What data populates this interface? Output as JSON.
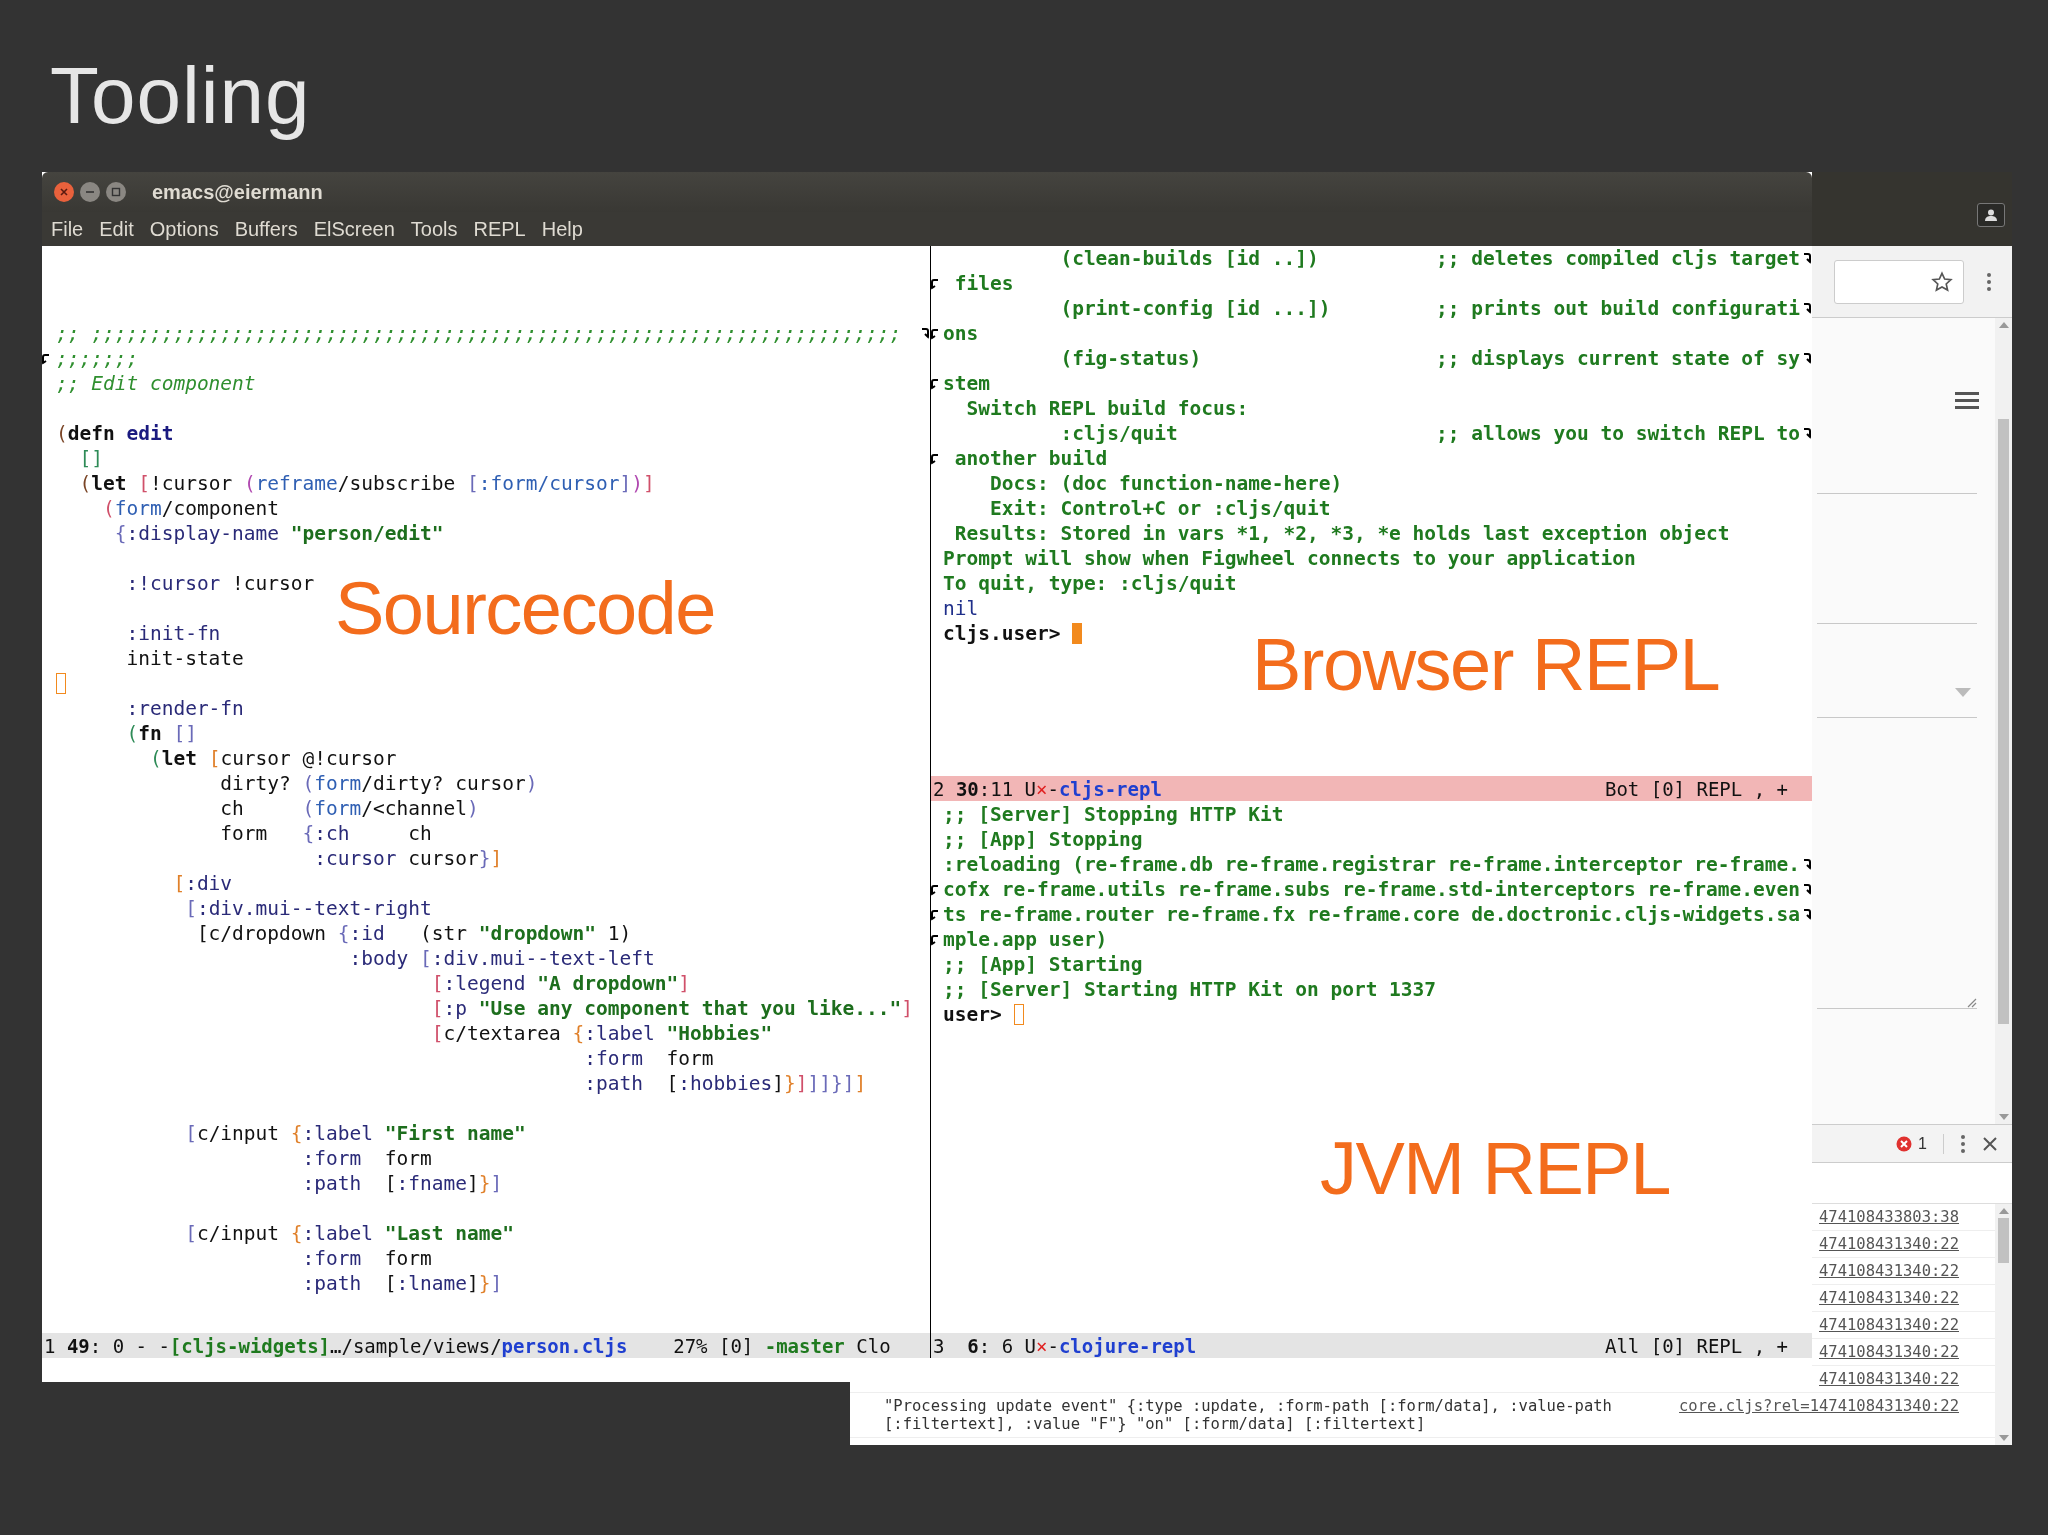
{
  "slide_title": "Tooling",
  "emacs": {
    "title": "emacs@eiermann",
    "menu": [
      "File",
      "Edit",
      "Options",
      "Buffers",
      "ElScreen",
      "Tools",
      "REPL",
      "Help"
    ],
    "source_window": {
      "focused": false,
      "lines": [
        {
          "kind": "code",
          "wraps": true,
          "continued": false,
          "segs": [
            {
              "kind": "comment",
              "text": ";; ;;;;;;;;;;;;;;;;;;;;;;;;;;;;;;;;;;;;;;;;;;;;;;;;;;;;;;;;;;;;;;;;;;;;;"
            }
          ]
        },
        {
          "kind": "code",
          "wraps": false,
          "continued": true,
          "segs": [
            {
              "kind": "comment",
              "text": ";;;;;;;"
            }
          ]
        },
        {
          "kind": "code",
          "wraps": false,
          "continued": false,
          "segs": [
            {
              "kind": "comment",
              "text": ";; Edit component"
            }
          ]
        },
        {
          "kind": "blank"
        },
        {
          "kind": "code",
          "wraps": false,
          "continued": false,
          "segs": [
            {
              "kind": "paren1",
              "text": "("
            },
            {
              "kind": "special",
              "text": "defn"
            },
            {
              "kind": "fname",
              "text": " edit"
            }
          ]
        },
        {
          "kind": "code",
          "wraps": false,
          "continued": false,
          "segs": [
            {
              "kind": "paren2",
              "text": "  []"
            }
          ]
        },
        {
          "kind": "code",
          "wraps": false,
          "continued": false,
          "segs": [
            {
              "kind": "paren1",
              "text": "  ("
            },
            {
              "kind": "special",
              "text": "let"
            },
            {
              "kind": "paren3",
              "text": " ["
            },
            {
              "kind": "plain",
              "text": "!cursor "
            },
            {
              "kind": "paren4",
              "text": "("
            },
            {
              "kind": "ns",
              "text": "reframe"
            },
            {
              "kind": "plain",
              "text": "/subscribe "
            },
            {
              "kind": "paren5",
              "text": "["
            },
            {
              "kind": "ns",
              "text": ":form/cursor"
            },
            {
              "kind": "paren5",
              "text": "]"
            },
            {
              "kind": "paren4",
              "text": ")"
            },
            {
              "kind": "paren3",
              "text": "]"
            }
          ]
        },
        {
          "kind": "code",
          "wraps": false,
          "continued": false,
          "segs": [
            {
              "kind": "paren3",
              "text": "    ("
            },
            {
              "kind": "ns",
              "text": "form"
            },
            {
              "kind": "plain",
              "text": "/component"
            }
          ]
        },
        {
          "kind": "code",
          "wraps": false,
          "continued": false,
          "segs": [
            {
              "kind": "paren5",
              "text": "     {"
            },
            {
              "kind": "kw",
              "text": ":display-name"
            },
            {
              "kind": "string",
              "text": " \"person/edit\""
            }
          ]
        },
        {
          "kind": "blank"
        },
        {
          "kind": "code",
          "wraps": false,
          "continued": false,
          "segs": [
            {
              "kind": "kw",
              "text": "      :!cursor"
            },
            {
              "kind": "plain",
              "text": " !cursor"
            }
          ]
        },
        {
          "kind": "blank"
        },
        {
          "kind": "code",
          "wraps": false,
          "continued": false,
          "segs": [
            {
              "kind": "kw",
              "text": "      :init-fn"
            }
          ]
        },
        {
          "kind": "code",
          "wraps": false,
          "continued": false,
          "segs": [
            {
              "kind": "plain",
              "text": "      init-state"
            }
          ]
        },
        {
          "kind": "cursor"
        },
        {
          "kind": "code",
          "wraps": false,
          "continued": false,
          "segs": [
            {
              "kind": "kw",
              "text": "      :render-fn"
            }
          ]
        },
        {
          "kind": "code",
          "wraps": false,
          "continued": false,
          "segs": [
            {
              "kind": "paren2",
              "text": "      ("
            },
            {
              "kind": "special",
              "text": "fn"
            },
            {
              "kind": "paren5",
              "text": " []"
            }
          ]
        },
        {
          "kind": "code",
          "wraps": false,
          "continued": false,
          "segs": [
            {
              "kind": "paren2",
              "text": "        ("
            },
            {
              "kind": "special",
              "text": "let"
            },
            {
              "kind": "paren6",
              "text": " ["
            },
            {
              "kind": "plain",
              "text": "cursor @!cursor"
            }
          ]
        },
        {
          "kind": "code",
          "wraps": false,
          "continued": false,
          "segs": [
            {
              "kind": "plain",
              "text": "              dirty? "
            },
            {
              "kind": "paren5",
              "text": "("
            },
            {
              "kind": "ns",
              "text": "form"
            },
            {
              "kind": "plain",
              "text": "/dirty? cursor"
            },
            {
              "kind": "paren5",
              "text": ")"
            }
          ]
        },
        {
          "kind": "code",
          "wraps": false,
          "continued": false,
          "segs": [
            {
              "kind": "plain",
              "text": "              ch     "
            },
            {
              "kind": "paren5",
              "text": "("
            },
            {
              "kind": "ns",
              "text": "form"
            },
            {
              "kind": "plain",
              "text": "/<channel"
            },
            {
              "kind": "paren5",
              "text": ")"
            }
          ]
        },
        {
          "kind": "code",
          "wraps": false,
          "continued": false,
          "segs": [
            {
              "kind": "plain",
              "text": "              form   "
            },
            {
              "kind": "paren5",
              "text": "{"
            },
            {
              "kind": "kw",
              "text": ":ch"
            },
            {
              "kind": "plain",
              "text": "     ch"
            }
          ]
        },
        {
          "kind": "code",
          "wraps": false,
          "continued": false,
          "segs": [
            {
              "kind": "kw",
              "text": "                      :cursor"
            },
            {
              "kind": "plain",
              "text": " cursor"
            },
            {
              "kind": "paren5",
              "text": "}"
            },
            {
              "kind": "paren6",
              "text": "]"
            }
          ]
        },
        {
          "kind": "code",
          "wraps": false,
          "continued": false,
          "segs": [
            {
              "kind": "paren6",
              "text": "          ["
            },
            {
              "kind": "kw",
              "text": ":div"
            }
          ]
        },
        {
          "kind": "code",
          "wraps": false,
          "continued": false,
          "segs": [
            {
              "kind": "paren5",
              "text": "           ["
            },
            {
              "kind": "kw",
              "text": ":div.mui--text-right"
            }
          ]
        },
        {
          "kind": "code",
          "wraps": false,
          "continued": false,
          "segs": [
            {
              "kind": "plain",
              "text": "            [c/dropdown "
            },
            {
              "kind": "paren5",
              "text": "{"
            },
            {
              "kind": "kw",
              "text": ":id"
            },
            {
              "kind": "plain",
              "text": "   (str "
            },
            {
              "kind": "string",
              "text": "\"dropdown\""
            },
            {
              "kind": "plain",
              "text": " 1)"
            }
          ]
        },
        {
          "kind": "code",
          "wraps": false,
          "continued": false,
          "segs": [
            {
              "kind": "kw",
              "text": "                         :body"
            },
            {
              "kind": "paren5",
              "text": " ["
            },
            {
              "kind": "kw",
              "text": ":div.mui--text-left"
            }
          ]
        },
        {
          "kind": "code",
          "wraps": false,
          "continued": false,
          "segs": [
            {
              "kind": "paren3",
              "text": "                                ["
            },
            {
              "kind": "kw",
              "text": ":legend"
            },
            {
              "kind": "string",
              "text": " \"A dropdown\""
            },
            {
              "kind": "paren3",
              "text": "]"
            }
          ]
        },
        {
          "kind": "code",
          "wraps": false,
          "continued": false,
          "segs": [
            {
              "kind": "paren3",
              "text": "                                ["
            },
            {
              "kind": "kw",
              "text": ":p"
            },
            {
              "kind": "string",
              "text": " \"Use any component that you like...\""
            },
            {
              "kind": "paren3",
              "text": "]"
            }
          ]
        },
        {
          "kind": "code",
          "wraps": false,
          "continued": false,
          "segs": [
            {
              "kind": "paren3",
              "text": "                                ["
            },
            {
              "kind": "plain",
              "text": "c/textarea "
            },
            {
              "kind": "paren6",
              "text": "{"
            },
            {
              "kind": "kw",
              "text": ":label"
            },
            {
              "kind": "string",
              "text": " \"Hobbies\""
            }
          ]
        },
        {
          "kind": "code",
          "wraps": false,
          "continued": false,
          "segs": [
            {
              "kind": "kw",
              "text": "                                             :form"
            },
            {
              "kind": "plain",
              "text": "  form"
            }
          ]
        },
        {
          "kind": "code",
          "wraps": false,
          "continued": false,
          "segs": [
            {
              "kind": "kw",
              "text": "                                             :path"
            },
            {
              "kind": "plain",
              "text": "  ["
            },
            {
              "kind": "kw",
              "text": ":hobbies"
            },
            {
              "kind": "plain",
              "text": "]"
            },
            {
              "kind": "paren6",
              "text": "}"
            },
            {
              "kind": "paren3",
              "text": "]"
            },
            {
              "kind": "paren5",
              "text": "]]}]"
            },
            {
              "kind": "paren6",
              "text": "]"
            }
          ]
        },
        {
          "kind": "blank"
        },
        {
          "kind": "code",
          "wraps": false,
          "continued": false,
          "segs": [
            {
              "kind": "paren5",
              "text": "           ["
            },
            {
              "kind": "plain",
              "text": "c/input "
            },
            {
              "kind": "paren6",
              "text": "{"
            },
            {
              "kind": "kw",
              "text": ":label"
            },
            {
              "kind": "string",
              "text": " \"First name\""
            }
          ]
        },
        {
          "kind": "code",
          "wraps": false,
          "continued": false,
          "segs": [
            {
              "kind": "kw",
              "text": "                     :form"
            },
            {
              "kind": "plain",
              "text": "  form"
            }
          ]
        },
        {
          "kind": "code",
          "wraps": false,
          "continued": false,
          "segs": [
            {
              "kind": "kw",
              "text": "                     :path"
            },
            {
              "kind": "plain",
              "text": "  ["
            },
            {
              "kind": "kw",
              "text": ":fname"
            },
            {
              "kind": "plain",
              "text": "]"
            },
            {
              "kind": "paren6",
              "text": "}"
            },
            {
              "kind": "paren5",
              "text": "]"
            }
          ]
        },
        {
          "kind": "blank"
        },
        {
          "kind": "code",
          "wraps": false,
          "continued": false,
          "segs": [
            {
              "kind": "paren5",
              "text": "           ["
            },
            {
              "kind": "plain",
              "text": "c/input "
            },
            {
              "kind": "paren6",
              "text": "{"
            },
            {
              "kind": "kw",
              "text": ":label"
            },
            {
              "kind": "string",
              "text": " \"Last name\""
            }
          ]
        },
        {
          "kind": "code",
          "wraps": false,
          "continued": false,
          "segs": [
            {
              "kind": "kw",
              "text": "                     :form"
            },
            {
              "kind": "plain",
              "text": "  form"
            }
          ]
        },
        {
          "kind": "code",
          "wraps": false,
          "continued": false,
          "segs": [
            {
              "kind": "kw",
              "text": "                     :path"
            },
            {
              "kind": "plain",
              "text": "  ["
            },
            {
              "kind": "kw",
              "text": ":lname"
            },
            {
              "kind": "plain",
              "text": "]"
            },
            {
              "kind": "paren6",
              "text": "}"
            },
            {
              "kind": "paren5",
              "text": "]"
            }
          ]
        }
      ],
      "mode_line": {
        "segments": [
          {
            "kind": "plain",
            "text": "1 "
          },
          {
            "kind": "bold",
            "text": "49"
          },
          {
            "kind": "plain",
            "text": ": 0 - -"
          },
          {
            "kind": "project",
            "text": "[cljs-widgets]"
          },
          {
            "kind": "plain",
            "text": "…/sample/views/"
          },
          {
            "kind": "buffer",
            "text": "person.cljs"
          },
          {
            "kind": "plain",
            "text": "    27% [0] "
          },
          {
            "kind": "project",
            "text": "-master"
          },
          {
            "kind": "plain",
            "text": " Clo"
          }
        ]
      }
    },
    "browser_repl_window": {
      "focused": true,
      "lines": [
        {
          "kind": "code",
          "wraps": true,
          "continued": false,
          "segs": [
            {
              "kind": "output",
              "text": "          (clean-builds [id ..])          ;; deletes compiled cljs target"
            }
          ]
        },
        {
          "kind": "code",
          "wraps": false,
          "continued": true,
          "segs": [
            {
              "kind": "output",
              "text": " files"
            }
          ]
        },
        {
          "kind": "code",
          "wraps": true,
          "continued": false,
          "segs": [
            {
              "kind": "output",
              "text": "          (print-config [id ...])         ;; prints out build configurati"
            }
          ]
        },
        {
          "kind": "code",
          "wraps": false,
          "continued": true,
          "segs": [
            {
              "kind": "output",
              "text": "ons"
            }
          ]
        },
        {
          "kind": "code",
          "wraps": true,
          "continued": false,
          "segs": [
            {
              "kind": "output",
              "text": "          (fig-status)                    ;; displays current state of sy"
            }
          ]
        },
        {
          "kind": "code",
          "wraps": false,
          "continued": true,
          "segs": [
            {
              "kind": "output",
              "text": "stem"
            }
          ]
        },
        {
          "kind": "code",
          "wraps": false,
          "continued": false,
          "segs": [
            {
              "kind": "output",
              "text": "  Switch REPL build focus:"
            }
          ]
        },
        {
          "kind": "code",
          "wraps": true,
          "continued": false,
          "segs": [
            {
              "kind": "output",
              "text": "          :cljs/quit                      ;; allows you to switch REPL to"
            }
          ]
        },
        {
          "kind": "code",
          "wraps": false,
          "continued": true,
          "segs": [
            {
              "kind": "output",
              "text": " another build"
            }
          ]
        },
        {
          "kind": "code",
          "wraps": false,
          "continued": false,
          "segs": [
            {
              "kind": "output",
              "text": "    Docs: (doc function-name-here)"
            }
          ]
        },
        {
          "kind": "code",
          "wraps": false,
          "continued": false,
          "segs": [
            {
              "kind": "output",
              "text": "    Exit: Control+C or :cljs/quit"
            }
          ]
        },
        {
          "kind": "code",
          "wraps": false,
          "continued": false,
          "segs": [
            {
              "kind": "output",
              "text": " Results: Stored in vars *1, *2, *3, *e holds last exception object"
            }
          ]
        },
        {
          "kind": "code",
          "wraps": false,
          "continued": false,
          "segs": [
            {
              "kind": "output",
              "text": "Prompt will show when Figwheel connects to your application"
            }
          ]
        },
        {
          "kind": "code",
          "wraps": false,
          "continued": false,
          "segs": [
            {
              "kind": "output",
              "text": "To quit, type: :cljs/quit"
            }
          ]
        },
        {
          "kind": "code",
          "wraps": false,
          "continued": false,
          "segs": [
            {
              "kind": "result",
              "text": "nil"
            }
          ]
        },
        {
          "kind": "prompt",
          "text": "cljs.user>"
        }
      ],
      "mode_line": {
        "segments": [
          {
            "kind": "plain",
            "text": "2 "
          },
          {
            "kind": "bold",
            "text": "30"
          },
          {
            "kind": "plain",
            "text": ":11 U"
          },
          {
            "kind": "modified",
            "text": "×"
          },
          {
            "kind": "plain",
            "text": "-"
          },
          {
            "kind": "buffer",
            "text": "cljs-repl"
          }
        ],
        "right": "Bot [0] REPL , +"
      }
    },
    "jvm_repl_window": {
      "focused": false,
      "lines": [
        {
          "kind": "code",
          "wraps": false,
          "continued": false,
          "segs": [
            {
              "kind": "output",
              "text": ";; [Server] Stopping HTTP Kit"
            }
          ]
        },
        {
          "kind": "code",
          "wraps": false,
          "continued": false,
          "segs": [
            {
              "kind": "output",
              "text": ";; [App] Stopping"
            }
          ]
        },
        {
          "kind": "code",
          "wraps": true,
          "continued": false,
          "segs": [
            {
              "kind": "output",
              "text": ":reloading (re-frame.db re-frame.registrar re-frame.interceptor re-frame."
            }
          ]
        },
        {
          "kind": "code",
          "wraps": true,
          "continued": true,
          "segs": [
            {
              "kind": "output",
              "text": "cofx re-frame.utils re-frame.subs re-frame.std-interceptors re-frame.even"
            }
          ]
        },
        {
          "kind": "code",
          "wraps": true,
          "continued": true,
          "segs": [
            {
              "kind": "output",
              "text": "ts re-frame.router re-frame.fx re-frame.core de.doctronic.cljs-widgets.sa"
            }
          ]
        },
        {
          "kind": "code",
          "wraps": false,
          "continued": true,
          "segs": [
            {
              "kind": "output",
              "text": "mple.app user)"
            }
          ]
        },
        {
          "kind": "code",
          "wraps": false,
          "continued": false,
          "segs": [
            {
              "kind": "output",
              "text": ";; [App] Starting"
            }
          ]
        },
        {
          "kind": "code",
          "wraps": false,
          "continued": false,
          "segs": [
            {
              "kind": "output",
              "text": ";; [Server] Starting HTTP Kit on port 1337"
            }
          ]
        },
        {
          "kind": "prompt",
          "text": "user>"
        }
      ],
      "mode_line": {
        "segments": [
          {
            "kind": "plain",
            "text": "3  "
          },
          {
            "kind": "bold",
            "text": "6"
          },
          {
            "kind": "plain",
            "text": ": 6 U"
          },
          {
            "kind": "modified",
            "text": "×"
          },
          {
            "kind": "plain",
            "text": "-"
          },
          {
            "kind": "buffer",
            "text": "clojure-repl"
          }
        ],
        "right": "All [0] REPL , +"
      }
    }
  },
  "browser": {
    "devtools": {
      "error_count": "1",
      "console_rows": [
        {
          "link": "474108433803:38"
        },
        {
          "link": "474108431340:22"
        },
        {
          "link": "474108431340:22"
        },
        {
          "link": "474108431340:22"
        },
        {
          "link": "474108431340:22"
        },
        {
          "link": "474108431340:22"
        },
        {
          "link": "474108431340:22"
        },
        {
          "message": "\"Processing update event\" {:type :update, :form-path [:form/data], :value-path [:filtertext], :value \"F\"} \"on\" [:form/data] [:filtertext]",
          "link": "core.cljs?rel=1474108431340:22"
        }
      ]
    }
  },
  "annotations": [
    "Sourcecode",
    "Browser REPL",
    "JVM REPL"
  ]
}
